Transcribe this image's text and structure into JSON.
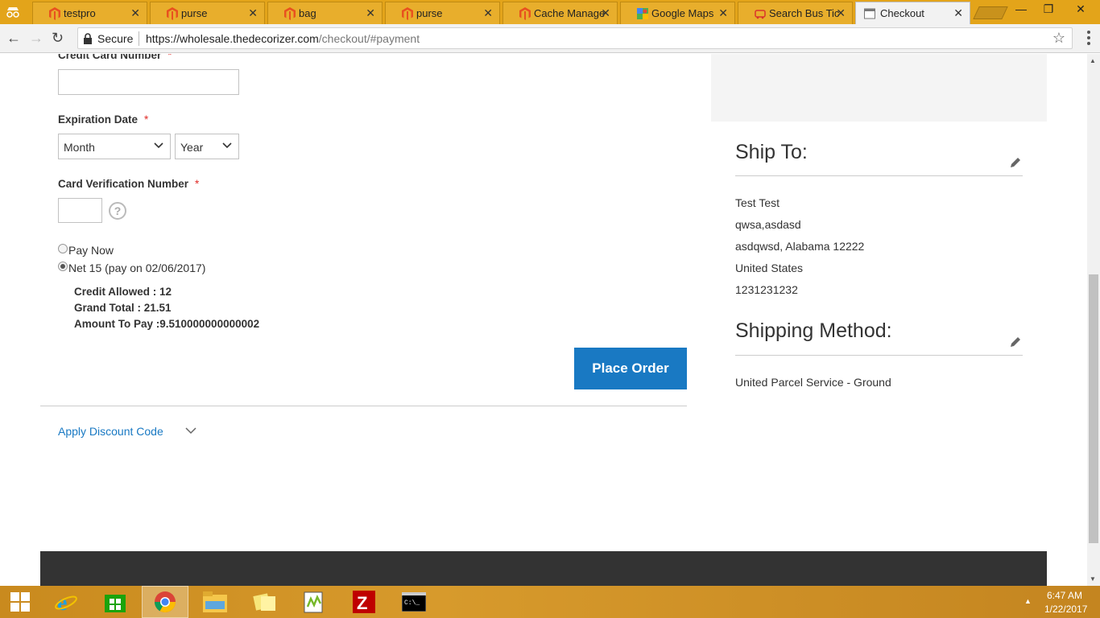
{
  "browser": {
    "tabs": [
      {
        "title": "testpro",
        "icon": "magento-icon"
      },
      {
        "title": "purse",
        "icon": "magento-icon"
      },
      {
        "title": "bag",
        "icon": "magento-icon"
      },
      {
        "title": "purse",
        "icon": "magento-icon"
      },
      {
        "title": "Cache Managem",
        "icon": "magento-icon"
      },
      {
        "title": "Google Maps",
        "icon": "maps-icon"
      },
      {
        "title": "Search Bus Ticke",
        "icon": "bus-icon"
      },
      {
        "title": "Checkout",
        "icon": "page-icon",
        "active": true
      }
    ],
    "secure_label": "Secure",
    "url_host": "https://wholesale.thedecorizer.com",
    "url_rest": "/checkout/#payment"
  },
  "payment": {
    "cc_number_label": "Credit Card Number",
    "required_mark": "*",
    "cc_number_value": "",
    "expiration_label": "Expiration Date",
    "month_value": "Month",
    "year_value": "Year",
    "cvv_label": "Card Verification Number",
    "help_glyph": "?",
    "options": [
      {
        "label": "Pay Now",
        "checked": false
      },
      {
        "label": "Net 15 (pay on 02/06/2017)",
        "checked": true
      }
    ],
    "credit_allowed": "Credit Allowed : 12",
    "grand_total": "Grand Total : 21.51",
    "amount_to_pay": "Amount To Pay :9.510000000000002",
    "place_order_label": "Place Order",
    "discount_label": "Apply Discount Code"
  },
  "sidebar": {
    "ship_to_title": "Ship To:",
    "address": [
      "Test Test",
      "qwsa,asdasd",
      "asdqwsd, Alabama 12222",
      "United States",
      "1231231232"
    ],
    "shipping_method_title": "Shipping Method:",
    "shipping_method": "United Parcel Service - Ground"
  },
  "taskbar": {
    "apps": [
      "windows-start-icon",
      "internet-explorer-icon",
      "store-icon",
      "chrome-icon",
      "file-explorer-icon",
      "sticky-notes-icon",
      "notepadpp-icon",
      "filezilla-icon",
      "cmd-icon"
    ],
    "time": "6:47 AM",
    "date": "1/22/2017"
  },
  "colors": {
    "accent": "#1979c3",
    "required": "#e02b27",
    "tabstrip": "#e3a41a"
  }
}
